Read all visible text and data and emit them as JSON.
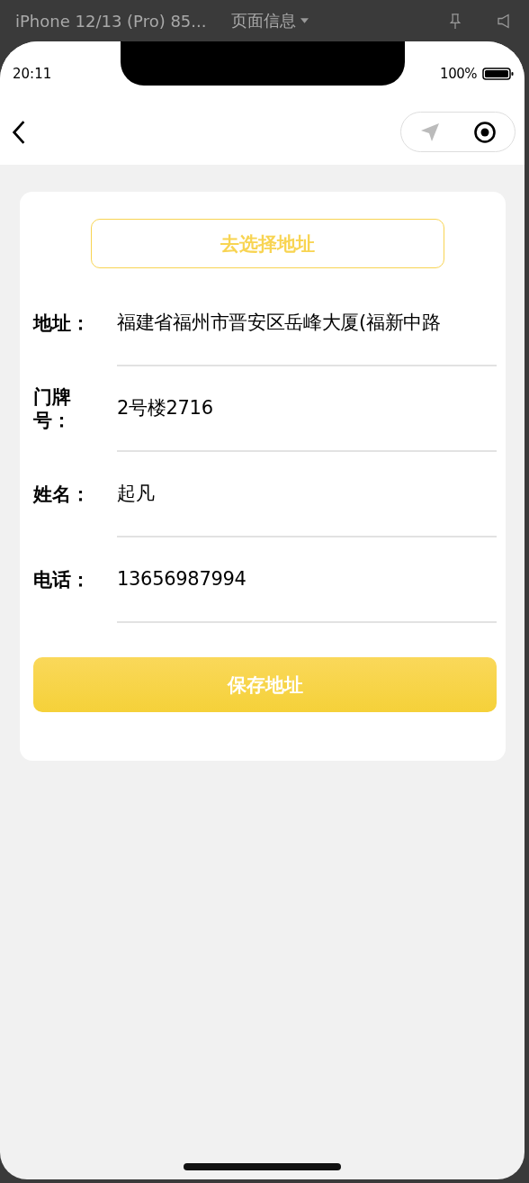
{
  "devtools_bar": {
    "device": "iPhone 12/13 (Pro) 85...",
    "page_info": "页面信息"
  },
  "status_bar": {
    "time": "20:11",
    "battery": "100%"
  },
  "choose_address_button": "去选择地址",
  "fields": [
    {
      "label": "地址：",
      "value": "福建省福州市晋安区岳峰大厦(福新中路"
    },
    {
      "label": "门牌号：",
      "value": "2号楼2716"
    },
    {
      "label": "姓名：",
      "value": "起凡"
    },
    {
      "label": "电话：",
      "value": "13656987994"
    }
  ],
  "save_button": "保存地址"
}
